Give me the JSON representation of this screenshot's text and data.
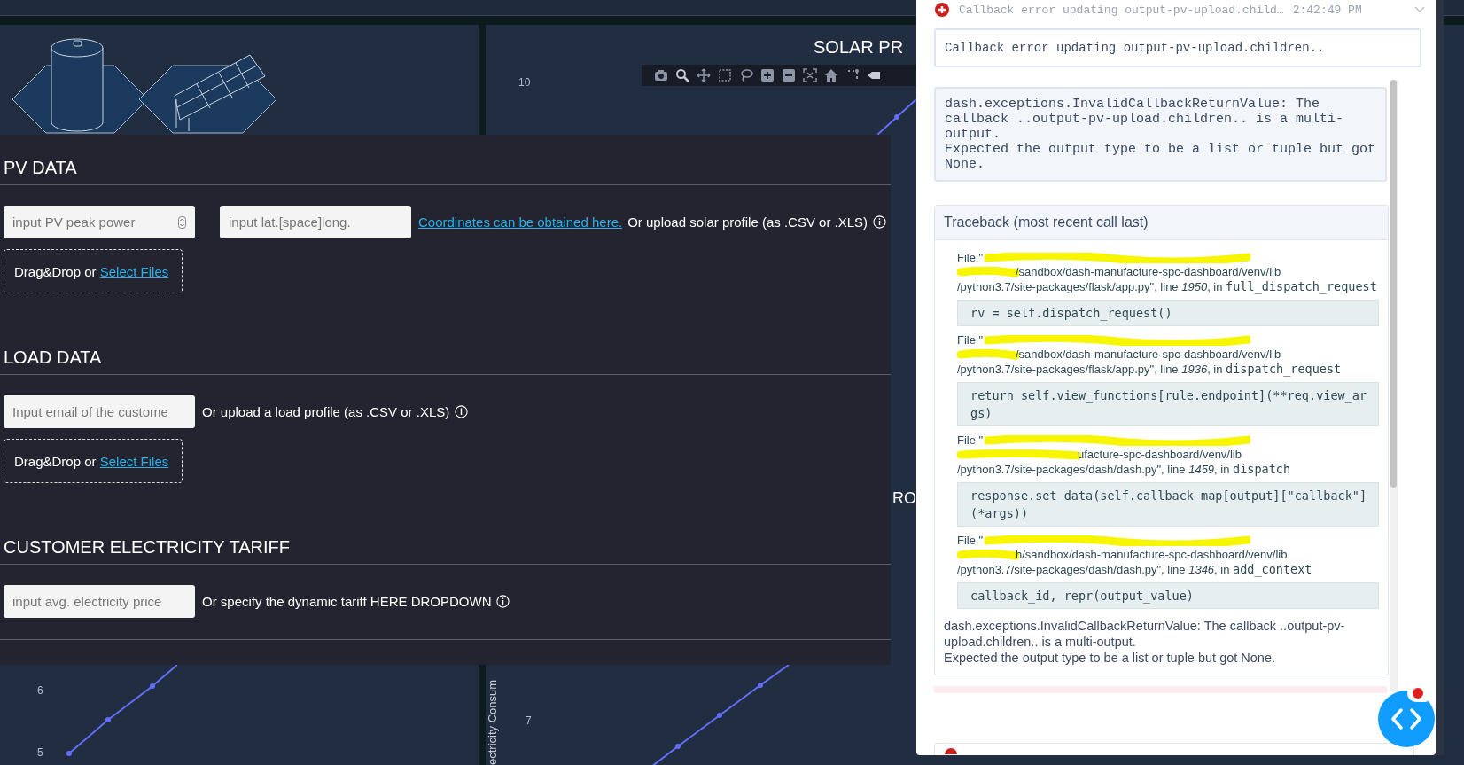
{
  "solar_chart": {
    "title": "SOLAR PR",
    "y_ticks": [
      "10"
    ]
  },
  "load_chart": {
    "title": "RO",
    "y_axis_label": "ectricity Consum",
    "y_ticks": [
      "7"
    ]
  },
  "health_chart": {
    "y_ticks": [
      "6",
      "5"
    ]
  },
  "form": {
    "sections": [
      {
        "heading": "PV DATA",
        "inputs": [
          {
            "kind": "number",
            "placeholder": "input PV peak power"
          },
          {
            "kind": "text",
            "placeholder": "input lat.[space]long."
          }
        ],
        "link": "Coordinates can be obtained here.",
        "note": "Or upload solar profile (as .CSV or .XLS)",
        "info_icon": true,
        "upload": {
          "text": "Drag&Drop or",
          "link": "Select Files"
        }
      },
      {
        "heading": "LOAD DATA",
        "inputs": [
          {
            "kind": "text",
            "placeholder": "Input email of the custome"
          }
        ],
        "note": "Or upload a load profile (as .CSV or .XLS)",
        "info_icon": true,
        "upload": {
          "text": "Drag&Drop or",
          "link": "Select Files"
        }
      },
      {
        "heading": "CUSTOMER ELECTRICITY TARIFF",
        "inputs": [
          {
            "kind": "text",
            "placeholder": "input avg. electricity price"
          }
        ],
        "note": "Or specify the dynamic tariff HERE DROPDOWN",
        "info_icon": true
      }
    ]
  },
  "error_panel": {
    "summary": "Callback error updating output-pv-upload.child…",
    "time": "2:42:49 PM",
    "expanded": true,
    "title": "Callback error updating output-pv-upload.children..",
    "message": "dash.exceptions.InvalidCallbackReturnValue: The callback ..output-pv-upload.children.. is a multi-output.\nExpected the output type to be a list or tuple but got None.",
    "traceback_title": "Traceback (most recent call last)",
    "frames": [
      {
        "file": "File \"",
        "path": "/sandbox/dash-manufacture-spc-dashboard/venv/lib",
        "location": "/python3.7/site-packages/flask/app.py\", line *1950*, in",
        "function": "full_dispatch_request",
        "code": "rv = self.dispatch_request()"
      },
      {
        "file": "File \"",
        "path": "/sandbox/dash-manufacture-spc-dashboard/venv/lib",
        "location": "/python3.7/site-packages/flask/app.py\", line *1936*, in",
        "function": "dispatch_request",
        "code": "return self.view_functions[rule.endpoint](**req.view_args)"
      },
      {
        "file": "File \"",
        "path": "ufacture-spc-dashboard/venv/lib",
        "location": "/python3.7/site-packages/dash/dash.py\", line *1459*, in",
        "function": "dispatch",
        "code": "response.set_data(self.callback_map[output][\"callback\"](*args))"
      },
      {
        "file": "File \"",
        "path": "h/sandbox/dash-manufacture-spc-dashboard/venv/lib",
        "location": "/python3.7/site-packages/dash/dash.py\", line *1346*, in",
        "function": "add_context",
        "code": "callback_id, repr(output_value)"
      }
    ],
    "footer": "dash.exceptions.InvalidCallbackReturnValue: The callback ..output-pv-upload.children.. is a multi-output.\nExpected the output type to be a list or tuple but got None."
  }
}
